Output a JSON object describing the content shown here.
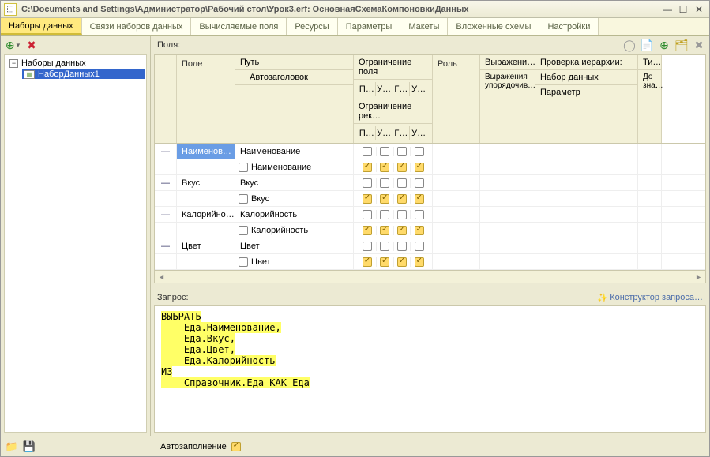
{
  "titlebar": {
    "path": "C:\\Documents and Settings\\Администратор\\Рабочий стол\\Урок3.erf: ОсновнаяСхемаКомпоновкиДанных"
  },
  "tabs": [
    "Наборы данных",
    "Связи наборов данных",
    "Вычисляемые поля",
    "Ресурсы",
    "Параметры",
    "Макеты",
    "Вложенные схемы",
    "Настройки"
  ],
  "left": {
    "tree_root": "Наборы данных",
    "item1": "НаборДанных1"
  },
  "fields_label": "Поля:",
  "grid": {
    "h_field": "Поле",
    "h_path": "Путь",
    "h_autoheader": "Автозаголовок",
    "h_restrict_field": "Ограничение поля",
    "h_restrict_rec": "Ограничение рек…",
    "h_role": "Роль",
    "h_expr": "Выражени…",
    "h_order_expr": "Выражения упорядочив…",
    "h_hier": "Проверка иерархии:",
    "h_dataset": "Набор данных",
    "h_param": "Параметр",
    "h_ti": "Ти…",
    "h_do": "До зна…",
    "sub_p": "П…",
    "sub_u1": "У…",
    "sub_g": "Г…",
    "sub_u2": "У…",
    "rows": [
      {
        "field": "Наименов…",
        "path": "Наименование",
        "sublabel": "Наименование",
        "field_sel": true
      },
      {
        "field": "Вкус",
        "path": "Вкус",
        "sublabel": "Вкус",
        "field_sel": false
      },
      {
        "field": "Калорийно…",
        "path": "Калорийность",
        "sublabel": "Калорийность",
        "field_sel": false
      },
      {
        "field": "Цвет",
        "path": "Цвет",
        "sublabel": "Цвет",
        "field_sel": false
      }
    ]
  },
  "query": {
    "label": "Запрос:",
    "constructor_link": "Конструктор запроса…",
    "query_text": "ВЫБРАТЬ\n    Еда.Наименование,\n    Еда.Вкус,\n    Еда.Цвет,\n    Еда.Калорийность\nИЗ\n    Справочник.Еда КАК Еда"
  },
  "bottom": {
    "autofill_label": "Автозаполнение"
  }
}
